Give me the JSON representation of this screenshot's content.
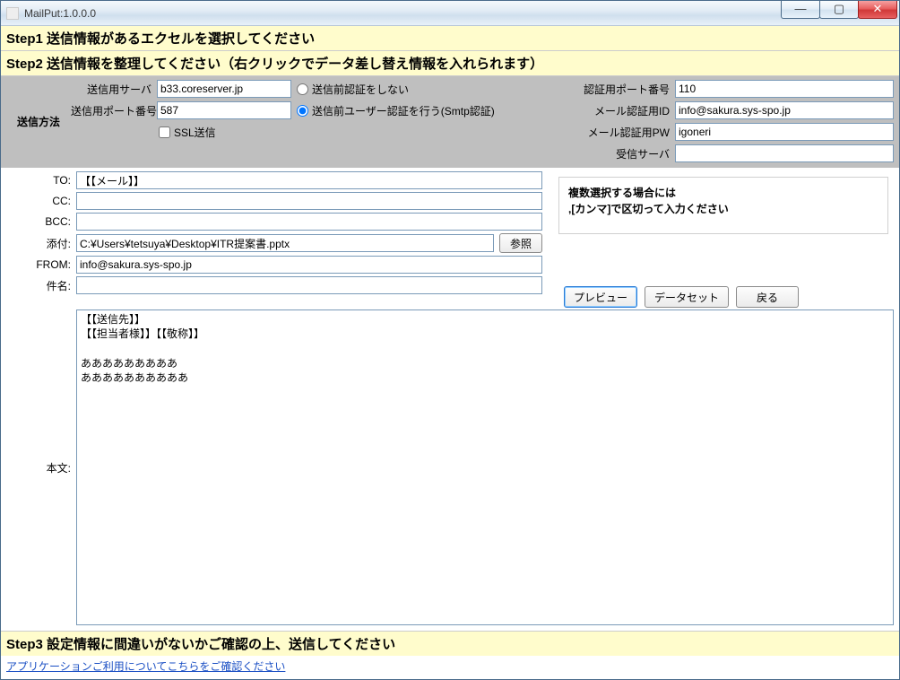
{
  "window": {
    "title": "MailPut:1.0.0.0"
  },
  "steps": {
    "step1": "Step1 送信情報があるエクセルを選択してください",
    "step2": "Step2 送信情報を整理してください（右クリックでデータ差し替え情報を入れられます）",
    "step3": "Step3 設定情報に間違いがないかご確認の上、送信してください"
  },
  "config": {
    "sidelabel": "送信方法",
    "send_server_label": "送信用サーバ",
    "send_server": "b33.coreserver.jp",
    "send_port_label": "送信用ポート番号",
    "send_port": "587",
    "ssl_label": "SSL送信",
    "radio_noauth": "送信前認証をしない",
    "radio_smtp": "送信前ユーザー認証を行う(Smtp認証)",
    "auth_port_label": "認証用ポート番号",
    "auth_port": "110",
    "mail_auth_id_label": "メール認証用ID",
    "mail_auth_id": "info@sakura.sys-spo.jp",
    "mail_auth_pw_label": "メール認証用PW",
    "mail_auth_pw": "igoneri",
    "recv_server_label": "受信サーバ",
    "recv_server": ""
  },
  "mail": {
    "to_label": "TO:",
    "to": "【【メール】】",
    "cc_label": "CC:",
    "cc": "",
    "bcc_label": "BCC:",
    "bcc": "",
    "attach_label": "添付:",
    "attach": "C:¥Users¥tetsuya¥Desktop¥ITR提案書.pptx",
    "browse_label": "参照",
    "from_label": "FROM:",
    "from": "info@sakura.sys-spo.jp",
    "subject_label": "件名:",
    "subject": "",
    "body_label": "本文:",
    "body": "【【送信先】】\n【【担当者様】】【【敬称】】\n\nあああああああああ\nああああああああああ"
  },
  "note": {
    "line1": "複数選択する場合には",
    "line2": ",[カンマ]で区切って入力ください"
  },
  "buttons": {
    "preview": "プレビュー",
    "dataset": "データセット",
    "back": "戻る"
  },
  "footer": {
    "link": "アプリケーションご利用についてこちらをご確認ください"
  }
}
